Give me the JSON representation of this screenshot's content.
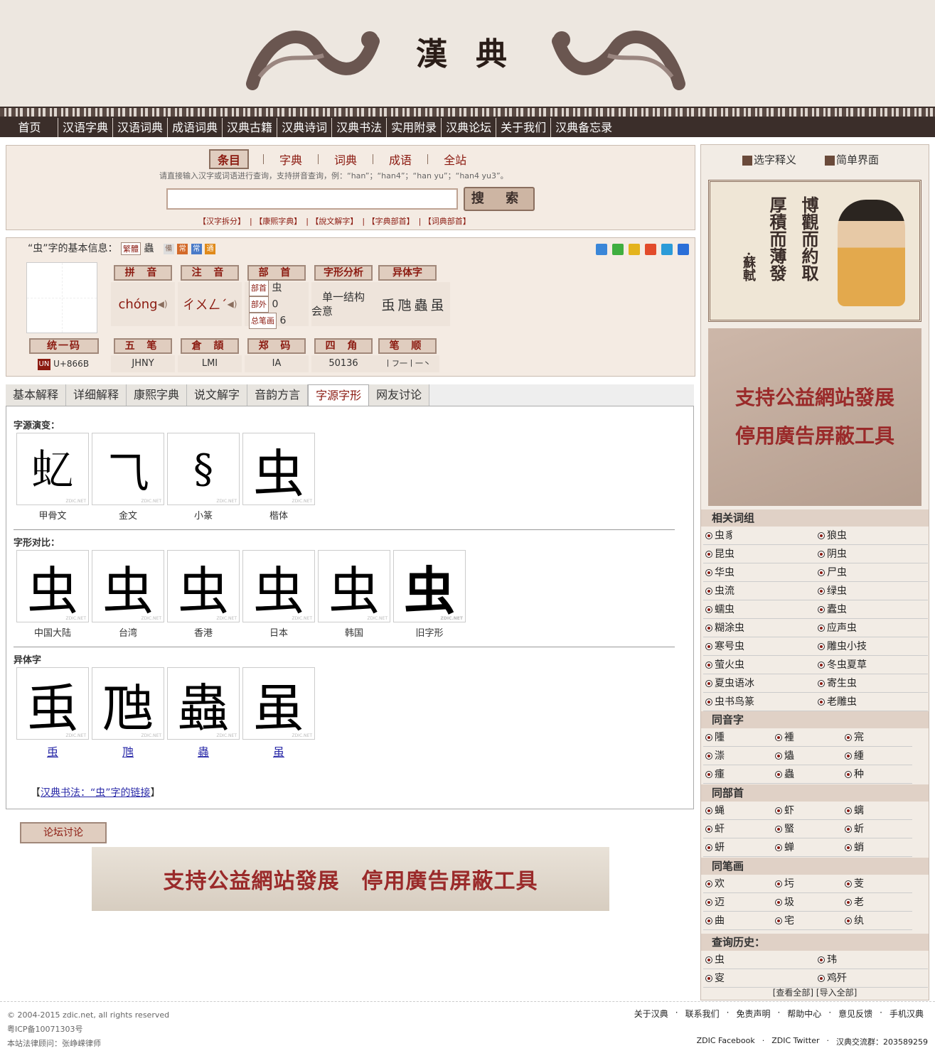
{
  "header": {
    "logo": "漢典"
  },
  "nav": [
    "首页",
    "汉语字典",
    "汉语词典",
    "成语词典",
    "汉典古籍",
    "汉典诗词",
    "汉典书法",
    "实用附录",
    "汉典论坛",
    "关于我们",
    "汉典备忘录"
  ],
  "search": {
    "tabs": [
      "条目",
      "字典",
      "词典",
      "成语",
      "全站"
    ],
    "active_tab": "条目",
    "hint": "请直接输入汉字或词语进行查询，支持拼音查询，例：“han”；“han4”；“han yu”；“han4 yu3”。",
    "input_value": "",
    "button_label": "搜 索",
    "links": [
      "【汉字拆分】",
      "【康熙字典】",
      "【說文解字】",
      "【字典部首】",
      "【词典部首】"
    ]
  },
  "basic": {
    "title": "“虫”字的基本信息：",
    "trad_badge": "繁體",
    "trad_char": "蟲",
    "badges": [
      "備",
      "常",
      "常",
      "通"
    ],
    "headers": [
      "拼 音",
      "注 音",
      "部 首",
      "字形分析",
      "异体字"
    ],
    "pinyin": "chóng",
    "zhuyin": "ㄔㄨㄥˊ",
    "bushou_labels": [
      "部首",
      "部外",
      "总笔画"
    ],
    "bushou_values": [
      "虫",
      "0",
      "6"
    ],
    "structure": [
      "单一结构",
      "会意"
    ],
    "variants": [
      "䖝",
      "虺",
      "蟲",
      "虽"
    ],
    "row2_headers": [
      "统一码",
      "五 笔",
      "倉 頡",
      "郑 码",
      "四 角",
      "笔 顺"
    ],
    "unicode": "U+866B",
    "wubi": "JHNY",
    "cangjie": "LMI",
    "zhengma": "IA",
    "sijiao": "50136",
    "bishun": "丨フ一丨一丶"
  },
  "tabs": [
    "基本解释",
    "详细解释",
    "康熙字典",
    "说文解字",
    "音韵方言",
    "字源字形",
    "网友讨论"
  ],
  "active_tab": "字源字形",
  "content": {
    "evolution_label": "字源演变：",
    "evolution": [
      {
        "glyph": "𧈝",
        "caption": "甲骨文"
      },
      {
        "glyph": "⺄",
        "caption": "金文"
      },
      {
        "glyph": "§",
        "caption": "小篆"
      },
      {
        "glyph": "虫",
        "caption": "楷体"
      }
    ],
    "compare_label": "字形对比：",
    "compare": [
      {
        "glyph": "虫",
        "caption": "中国大陆"
      },
      {
        "glyph": "虫",
        "caption": "台湾"
      },
      {
        "glyph": "虫",
        "caption": "香港"
      },
      {
        "glyph": "虫",
        "caption": "日本"
      },
      {
        "glyph": "虫",
        "caption": "韩国"
      },
      {
        "glyph": "虫",
        "caption": "旧字形"
      }
    ],
    "variant_label": "异体字",
    "variants": [
      {
        "glyph": "䖝",
        "caption": "䖝"
      },
      {
        "glyph": "虺",
        "caption": "虺"
      },
      {
        "glyph": "蟲",
        "caption": "蟲"
      },
      {
        "glyph": "虽",
        "caption": "虽"
      }
    ],
    "watermark": "ZDIC.NET",
    "calli_prefix": "【",
    "calli_link": "汉典书法：“虫”字的链接",
    "calli_suffix": "】"
  },
  "forum_label": "论坛讨论",
  "banner_text": "支持公益網站發展　停用廣告屏蔽工具",
  "sidebar": {
    "links": [
      "选字释义",
      "简单界面"
    ],
    "portrait_poem": [
      "博觀而約取",
      "厚積而薄發"
    ],
    "portrait_author": "·蘇軾",
    "banner_lines": [
      "支持公益網站發展",
      "停用廣告屏蔽工具"
    ],
    "sections": [
      {
        "title": "相关词组",
        "cols": 2,
        "items": [
          "虫豸",
          "狼虫",
          "昆虫",
          "阴虫",
          "华虫",
          "尸虫",
          "虫流",
          "绿虫",
          "蠕虫",
          "蠹虫",
          "糊涂虫",
          "应声虫",
          "寒号虫",
          "雕虫小技",
          "萤火虫",
          "冬虫夏草",
          "夏虫语冰",
          "寄生虫",
          "虫书鸟篆",
          "老雕虫"
        ]
      },
      {
        "title": "同音字",
        "cols": 3,
        "items": [
          "隀",
          "褈",
          "宺",
          "漴",
          "爞",
          "緟",
          "瘇",
          "蟲",
          "种"
        ]
      },
      {
        "title": "同部首",
        "cols": 3,
        "items": [
          "蝇",
          "虾",
          "螭",
          "虷",
          "蜸",
          "蚚",
          "蚈",
          "蝉",
          "蛸"
        ]
      },
      {
        "title": "同笔画",
        "cols": 3,
        "items": [
          "欢",
          "圬",
          "芰",
          "迈",
          "圾",
          "老",
          "曲",
          "宅",
          "纨"
        ]
      },
      {
        "title": "查询历史：",
        "cols": 2,
        "items": [
          "虫",
          "玮",
          "叜",
          "鸡歼"
        ]
      }
    ],
    "history_foot": "[查看全部] [导入全部]"
  },
  "footer": {
    "copyright": "© 2004-2015 zdic.net, all rights reserved",
    "icp": "粤ICP备10071303号",
    "lawyer": "本站法律顾问：张峥嵘律师",
    "links": [
      "关于汉典",
      "·",
      "联系我们",
      "·",
      "免责声明",
      "·",
      "帮助中心",
      "·",
      "意见反馈",
      "·",
      "手机汉典"
    ],
    "links2": [
      "ZDIC Facebook",
      "·",
      "ZDIC Twitter",
      "·",
      "汉典交流群：203589259"
    ]
  }
}
